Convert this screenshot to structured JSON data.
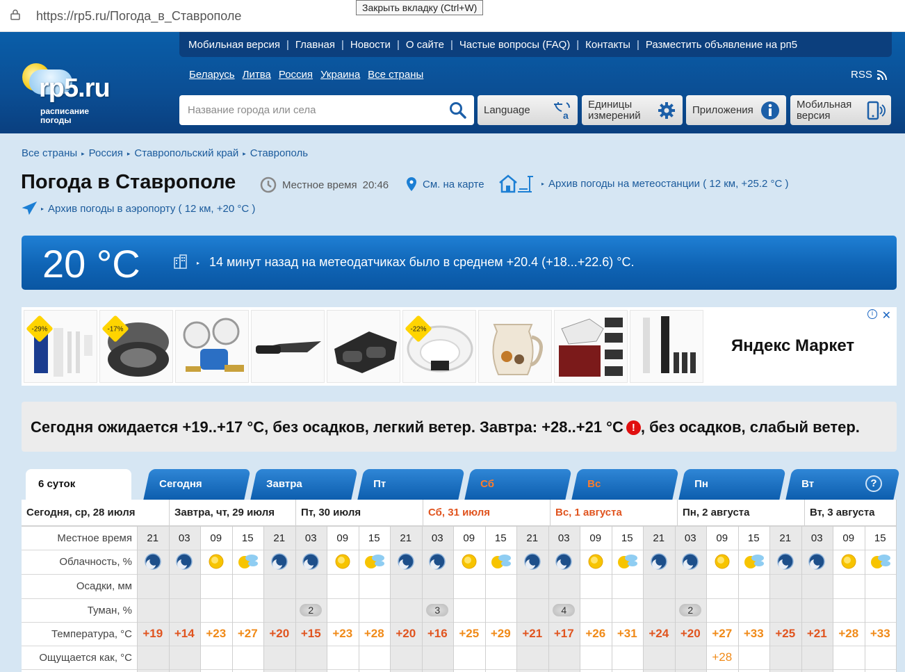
{
  "browser": {
    "url": "https://rp5.ru/Погода_в_Ставрополе",
    "tooltip": "Закрыть вкладку (Ctrl+W)"
  },
  "header": {
    "logo_text": "rp5.ru",
    "logo_tagline_1": "расписание",
    "logo_tagline_2": "погоды",
    "topnav": [
      "Мобильная версия",
      "Главная",
      "Новости",
      "О сайте",
      "Частые вопросы (FAQ)",
      "Контакты",
      "Разместить объявление на рп5"
    ],
    "countries": [
      "Беларусь",
      "Литва",
      "Россия",
      "Украина",
      "Все страны"
    ],
    "rss": "RSS",
    "search_placeholder": "Название города или села",
    "buttons": {
      "language": "Language",
      "units_1": "Единицы",
      "units_2": "измерений",
      "apps": "Приложения",
      "mobile_1": "Мобильная",
      "mobile_2": "версия"
    }
  },
  "breadcrumb": [
    "Все страны",
    "Россия",
    "Ставропольский край",
    "Ставрополь"
  ],
  "page": {
    "title": "Погода в Ставрополе",
    "local_time_label": "Местное время",
    "local_time": "20:46",
    "map_link": "См. на карте",
    "archive_station": "Архив погоды на метеостанции ( 12 км, +25.2 °C )",
    "archive_airport": "Архив погоды в аэропорту ( 12 км, +20 °C )"
  },
  "now": {
    "temp": "20 °C",
    "text": "14 минут назад на метеодатчиках было в среднем +20.4 (+18...+22.6) °C."
  },
  "ad": {
    "discounts": [
      "-29%",
      "-17%",
      "-22%"
    ],
    "brand": "Яндекс Маркет"
  },
  "summary": {
    "part1": "Сегодня ожидается +19..+17 °C, без осадков, легкий ветер. Завтра: +28..+21 °C",
    "part2": ", без осадков, слабый ветер."
  },
  "tabs": {
    "first": "6 суток",
    "days": [
      "Сегодня",
      "Завтра",
      "Пт",
      "Сб",
      "Вс",
      "Пн",
      "Вт"
    ],
    "help": "?"
  },
  "table": {
    "day_headers": [
      "Сегодня, ср, 28 июля",
      "Завтра, чт, 29 июля",
      "Пт, 30 июля",
      "Сб, 31 июля",
      "Вс, 1 августа",
      "Пн, 2 августа",
      "Вт, 3 августа"
    ],
    "row_labels": [
      "Местное время",
      "Облачность, %",
      "Осадки, мм",
      "Туман, %",
      "Температура, °C",
      "Ощущается как, °C"
    ],
    "hours": [
      "21",
      "03",
      "09",
      "15",
      "21",
      "03",
      "09",
      "15",
      "21",
      "03",
      "09",
      "15",
      "21",
      "03",
      "09",
      "15",
      "21",
      "03",
      "09",
      "15",
      "21",
      "03",
      "09",
      "15"
    ],
    "fog": {
      "5": "2",
      "9": "3",
      "13": "4",
      "17": "2"
    },
    "temps": [
      "+19",
      "+14",
      "+23",
      "+27",
      "+20",
      "+15",
      "+23",
      "+28",
      "+20",
      "+16",
      "+25",
      "+29",
      "+21",
      "+17",
      "+26",
      "+31",
      "+24",
      "+20",
      "+27",
      "+33",
      "+25",
      "+21",
      "+28",
      "+33"
    ],
    "feels_like": {
      "18": "+28"
    },
    "colors": {
      "warm": "#e0541f",
      "hot": "#f08a18",
      "night_bg": "#e9e9e9"
    }
  }
}
